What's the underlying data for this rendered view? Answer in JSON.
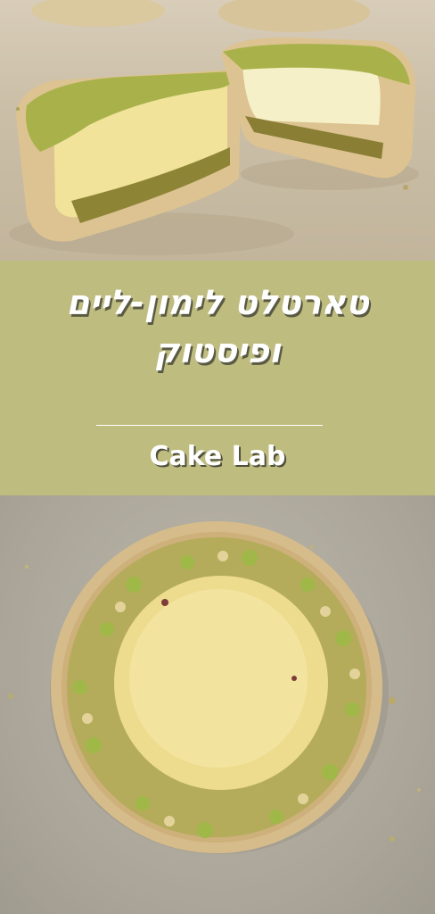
{
  "title": "טארטלט לימון-ליים ופיסטוק",
  "brand": "Cake Lab",
  "images": {
    "top": "halved-lemon-tart-photo",
    "bottom": "whole-lemon-tart-topdown-photo"
  },
  "colors": {
    "banner": "#bebc7f",
    "text": "#ffffff",
    "crust": "#d9bf8e",
    "curd": "#efdf8e",
    "pistachio": "#a8b84a"
  }
}
